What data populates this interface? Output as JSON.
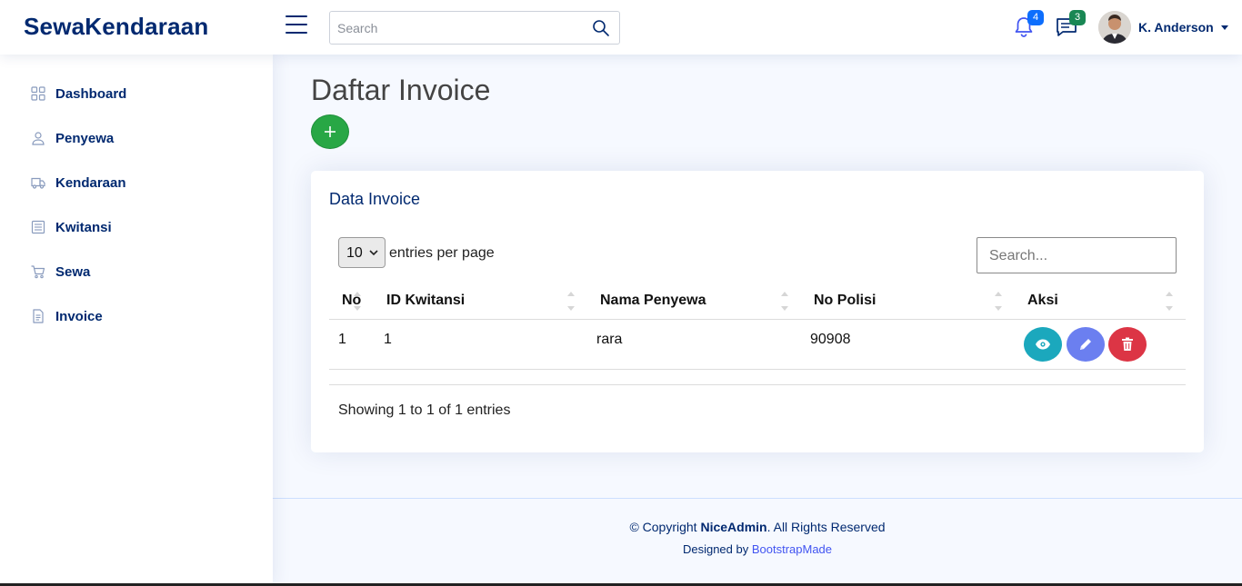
{
  "header": {
    "logo": "SewaKendaraan",
    "search_placeholder": "Search",
    "notifications_count": "4",
    "messages_count": "3",
    "profile_name": "K. Anderson"
  },
  "sidebar": {
    "items": [
      {
        "label": "Dashboard",
        "icon": "grid-icon"
      },
      {
        "label": "Penyewa",
        "icon": "person-icon"
      },
      {
        "label": "Kendaraan",
        "icon": "truck-icon"
      },
      {
        "label": "Kwitansi",
        "icon": "receipt-icon"
      },
      {
        "label": "Sewa",
        "icon": "cart-icon"
      },
      {
        "label": "Invoice",
        "icon": "file-icon"
      }
    ]
  },
  "main": {
    "page_title": "Daftar Invoice",
    "card_title": "Data Invoice",
    "entries_value": "10",
    "entries_label": "entries per page",
    "table_search_placeholder": "Search...",
    "columns": [
      "No",
      "ID Kwitansi",
      "Nama Penyewa",
      "No Polisi",
      "Aksi"
    ],
    "rows": [
      {
        "no": "1",
        "id_kwitansi": "1",
        "nama_penyewa": "rara",
        "no_polisi": "90908"
      }
    ],
    "showing_text": "Showing 1 to 1 of 1 entries"
  },
  "footer": {
    "copyright_prefix": "© Copyright ",
    "copyright_brand": "NiceAdmin",
    "copyright_suffix": ". All Rights Reserved",
    "designed_by": "Designed by ",
    "designer_link": "BootstrapMade"
  },
  "colors": {
    "brand": "#012970",
    "add_button": "#28a745",
    "view_button": "#1ba8bd",
    "edit_button": "#6b7ff0",
    "delete_button": "#dc3545"
  }
}
